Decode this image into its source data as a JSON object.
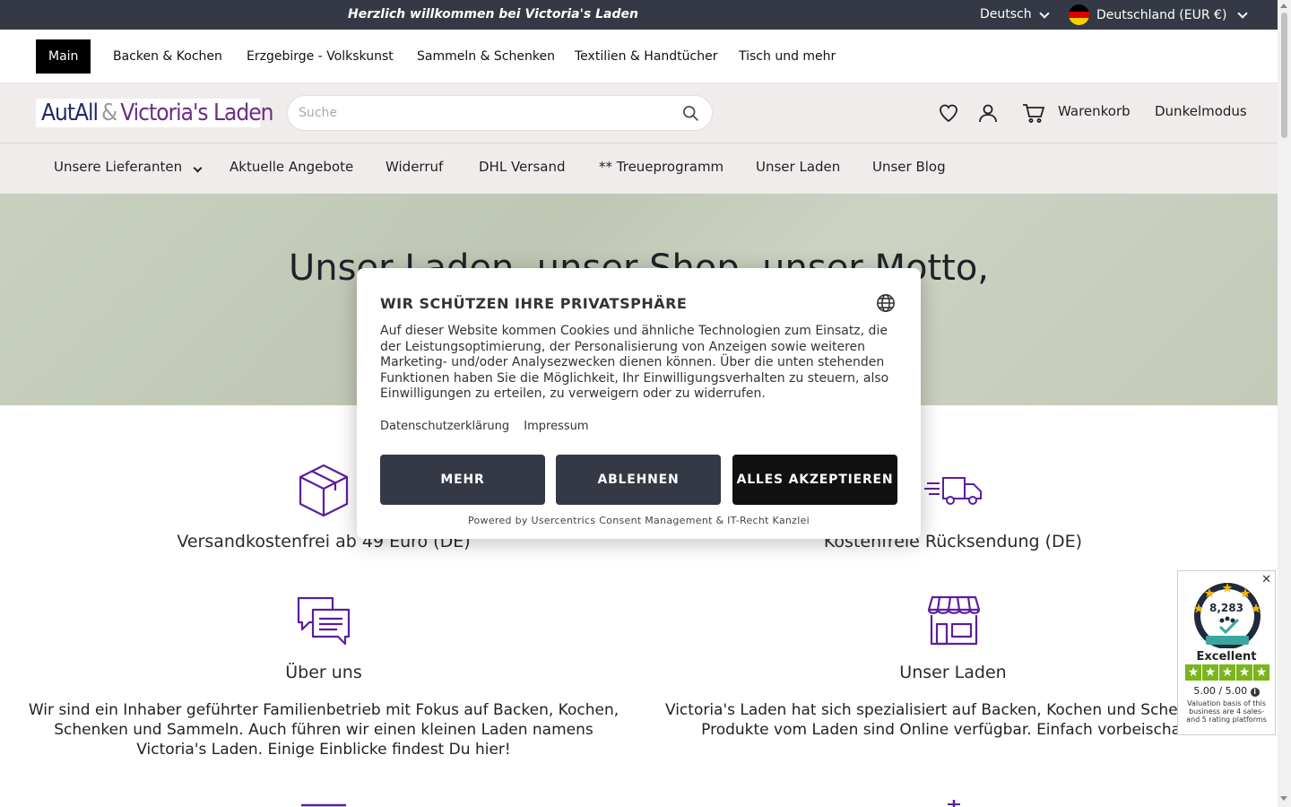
{
  "topbar": {
    "welcome": "Herzlich willkommen bei Victoria's Laden",
    "language": "Deutsch",
    "country": "Deutschland (EUR €)"
  },
  "catnav": [
    "Main",
    "Backen & Kochen",
    "Erzgebirge - Volkskunst",
    "Sammeln & Schenken",
    "Textilien & Handtücher",
    "Tisch und mehr"
  ],
  "header": {
    "logo_part1": "AutAll",
    "logo_amp": "&",
    "logo_part2": "Victoria's Laden",
    "search_placeholder": "Suche",
    "cart_label": "Warenkorb",
    "darkmode_label": "Dunkelmodus"
  },
  "mainnav": [
    "Unsere Lieferanten",
    "Aktuelle Angebote",
    "Widerruf",
    "DHL Versand",
    "** Treueprogramm",
    "Unser Laden",
    "Unser Blog"
  ],
  "hero": {
    "title": "Unser Laden, unser Shop, unser Motto,"
  },
  "features": {
    "shipping_free": "Versandkostenfrei ab 49 Euro (DE)",
    "return_free": "Kostenfreie Rücksendung (DE)",
    "about_title": "Über uns",
    "about_text": "Wir sind ein Inhaber geführter Familienbetrieb mit Fokus auf Backen, Kochen, Schenken und Sammeln. Auch führen wir einen kleinen Laden namens Victoria's Laden. Einige Einblicke findest Du hier!",
    "shop_title": "Unser Laden",
    "shop_text": "Victoria's Laden hat sich spezialisiert auf Backen, Kochen und Schenken, alle Produkte vom Laden sind Online verfügbar. Einfach vorbeischauen!"
  },
  "consent": {
    "title": "WIR SCHÜTZEN IHRE PRIVATSPHÄRE",
    "body": "Auf dieser Website kommen Cookies und ähnliche Technologien zum Einsatz, die der Leistungsoptimierung, der Personalisierung von Anzeigen sowie weiteren Marketing- und/oder Analysezwecken dienen können. Über die unten stehenden Funktionen haben Sie die Möglichkeit, Ihr Einwilligungsverhalten zu steuern, also Einwilligungen zu erteilen, zu verweigern oder zu widerrufen.",
    "link_privacy": "Datenschutzerklärung",
    "link_imprint": "Impressum",
    "btn_more": "MEHR",
    "btn_decline": "ABLEHNEN",
    "btn_accept": "ALLES AKZEPTIEREN",
    "powered": "Powered by Usercentrics Consent Management & IT-Recht Kanzlei"
  },
  "trust": {
    "close": "✕",
    "count": "8,283",
    "rating_word": "Excellent",
    "score": "5.00 / 5.00",
    "basis": "Valuation basis of this business are 4 sales- and 5 rating platforms"
  },
  "colors": {
    "topbar": "#343945",
    "accent_purple": "#5b1f9e",
    "button_grey": "#343945",
    "button_black": "#111111",
    "trust_green": "#7ab51d"
  }
}
